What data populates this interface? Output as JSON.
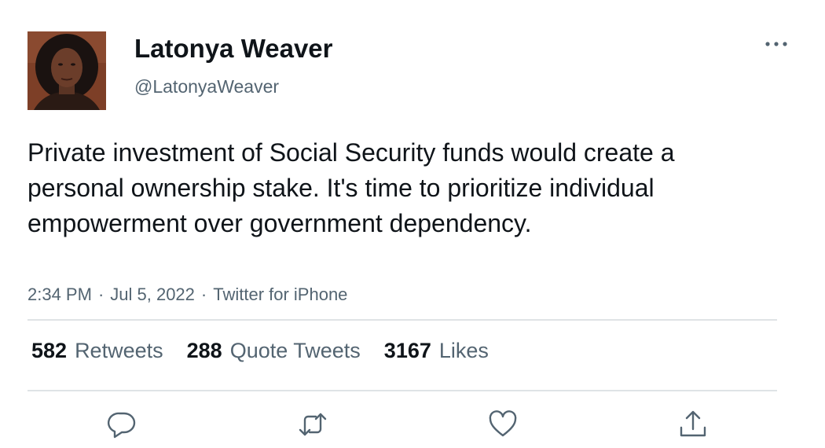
{
  "tweet": {
    "author": {
      "display_name": "Latonya Weaver",
      "handle": "@LatonyaWeaver",
      "avatar_icon": "profile-photo"
    },
    "text": "Private investment of Social Security funds would create a personal ownership stake. It's time to prioritize individual empowerment over government dependency.",
    "time": "2:34 PM",
    "date": "Jul 5, 2022",
    "source": "Twitter for iPhone",
    "separator": "·",
    "stats": {
      "retweets": {
        "count": "582",
        "label": "Retweets"
      },
      "quotes": {
        "count": "288",
        "label": "Quote Tweets"
      },
      "likes": {
        "count": "3167",
        "label": "Likes"
      }
    },
    "actions": [
      "reply-icon",
      "retweet-icon",
      "like-icon",
      "share-icon"
    ],
    "menu_icon": "more-icon"
  },
  "colors": {
    "text_primary": "#0f1419",
    "text_secondary": "#536471",
    "divider": "#dfe3e6",
    "icon": "#536471"
  }
}
